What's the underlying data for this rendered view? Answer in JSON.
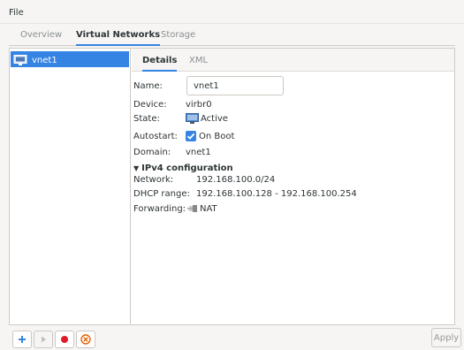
{
  "menubar": {
    "file": "File"
  },
  "tabs": [
    "Overview",
    "Virtual Networks",
    "Storage"
  ],
  "network_list": [
    {
      "name": "vnet1",
      "icon": "network-icon"
    }
  ],
  "detail_tabs": [
    "Details",
    "XML"
  ],
  "details": {
    "name_label": "Name:",
    "name_value": "vnet1",
    "device_label": "Device:",
    "device_value": "virbr0",
    "state_label": "State:",
    "state_value": "Active",
    "autostart_label": "Autostart:",
    "autostart_value": "On Boot",
    "autostart_checked": true,
    "domain_label": "Domain:",
    "domain_value": "vnet1"
  },
  "ipv4": {
    "title": "IPv4 configuration",
    "network_label": "Network:",
    "network_value": "192.168.100.0/24",
    "dhcp_label": "DHCP range:",
    "dhcp_value": "192.168.100.128 - 192.168.100.254",
    "forwarding_label": "Forwarding:",
    "forwarding_value": "NAT"
  },
  "toolbar": {
    "buttons": [
      "add-icon",
      "start-icon",
      "stop-icon",
      "delete-icon"
    ],
    "apply_label": "Apply"
  },
  "colors": {
    "accent": "#3584e4",
    "stop": "#e01b24",
    "delete": "#e66100"
  }
}
